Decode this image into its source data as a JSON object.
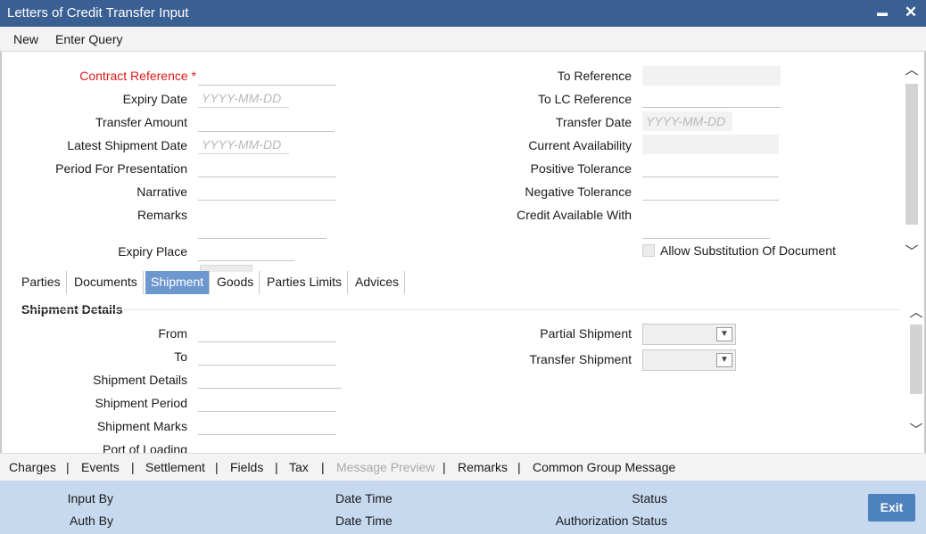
{
  "window": {
    "title": "Letters of Credit Transfer Input",
    "minimize_glyph": "▬",
    "close_glyph": "✕"
  },
  "toolbar": {
    "new_label": "New",
    "enter_query_label": "Enter Query"
  },
  "header_left": {
    "contract_reference": "Contract Reference",
    "required_marker": "*",
    "expiry_date": "Expiry Date",
    "expiry_date_placeholder": "YYYY-MM-DD",
    "transfer_amount": "Transfer Amount",
    "latest_shipment_date": "Latest Shipment Date",
    "latest_shipment_date_placeholder": "YYYY-MM-DD",
    "period_for_presentation": "Period For Presentation",
    "narrative": "Narrative",
    "remarks": "Remarks",
    "expiry_place": "Expiry Place"
  },
  "header_right": {
    "to_reference": "To Reference",
    "to_lc_reference": "To LC Reference",
    "transfer_date": "Transfer Date",
    "transfer_date_placeholder": "YYYY-MM-DD",
    "current_availability": "Current Availability",
    "positive_tolerance": "Positive Tolerance",
    "negative_tolerance": "Negative Tolerance",
    "credit_available_with": "Credit Available With",
    "allow_substitution": "Allow Substitution Of Document"
  },
  "tabs": [
    {
      "label": "Parties"
    },
    {
      "label": "Documents"
    },
    {
      "label": "Shipment"
    },
    {
      "label": "Goods"
    },
    {
      "label": "Parties Limits"
    },
    {
      "label": "Advices"
    }
  ],
  "active_tab": "Shipment",
  "shipment": {
    "section_title": "Shipment Details",
    "from": "From",
    "to": "To",
    "shipment_details": "Shipment Details",
    "shipment_period": "Shipment Period",
    "shipment_marks": "Shipment Marks",
    "port_of_loading": "Port of Loading",
    "partial_shipment": "Partial Shipment",
    "transfer_shipment": "Transfer Shipment"
  },
  "scroll": {
    "up_glyph": "︿",
    "down_glyph": "﹀"
  },
  "select_arrow_glyph": "▼",
  "linkbar": {
    "separator": "|",
    "items": [
      {
        "label": "Charges"
      },
      {
        "label": "Events"
      },
      {
        "label": "Settlement"
      },
      {
        "label": "Fields"
      },
      {
        "label": "Tax"
      },
      {
        "label": "Message Preview"
      },
      {
        "label": "Remarks"
      },
      {
        "label": "Common Group Message"
      }
    ]
  },
  "footer": {
    "input_by": "Input By",
    "auth_by": "Auth By",
    "date_time_1": "Date Time",
    "date_time_2": "Date Time",
    "status": "Status",
    "authorization_status": "Authorization Status",
    "exit_label": "Exit"
  },
  "colors": {
    "title_bar": "#3a5f93",
    "active_tab": "#6d97cf",
    "footer": "#c6d9ef",
    "exit_button": "#4e82bd",
    "required": "#e01818"
  }
}
